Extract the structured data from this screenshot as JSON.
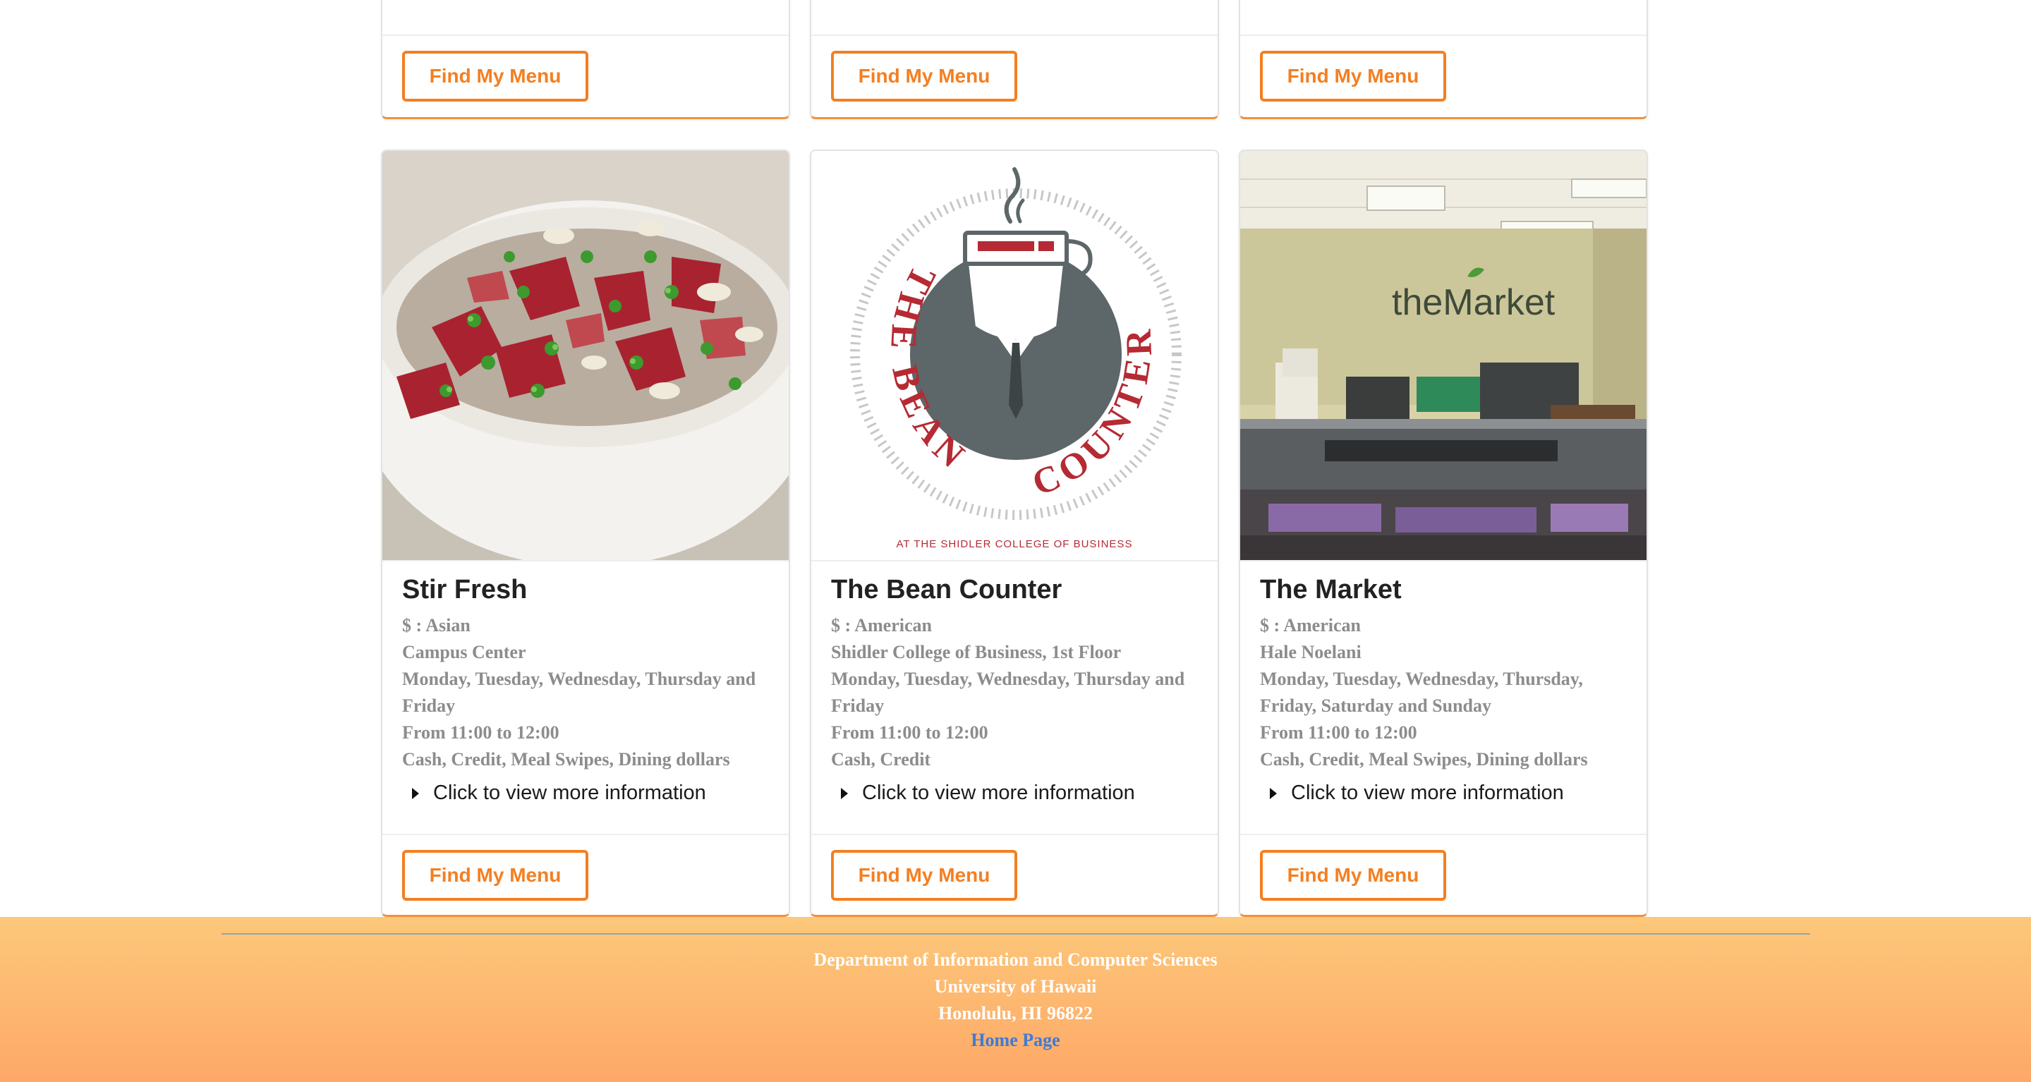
{
  "colors": {
    "accent": "#f47f21",
    "footer_top": "#fcc87a",
    "footer_bottom": "#fea867",
    "link": "#3f7ad6"
  },
  "top_cards": [
    {
      "button_label": "Find My Menu"
    },
    {
      "button_label": "Find My Menu"
    },
    {
      "button_label": "Find My Menu"
    }
  ],
  "cards": [
    {
      "name": "Stir Fresh",
      "price_cuisine": "$ : Asian",
      "location": "Campus Center",
      "days": "Monday, Tuesday, Wednesday, Thursday and Friday",
      "hours": "From 11:00 to 12:00",
      "payment": "Cash, Credit, Meal Swipes, Dining dollars",
      "more_label": "Click to view more information",
      "button_label": "Find My Menu",
      "image": "poke-bowl-photo"
    },
    {
      "name": "The Bean Counter",
      "price_cuisine": "$ : American",
      "location": "Shidler College of Business, 1st Floor",
      "days": "Monday, Tuesday, Wednesday, Thursday and Friday",
      "hours": "From 11:00 to 12:00",
      "payment": "Cash, Credit",
      "more_label": "Click to view more information",
      "button_label": "Find My Menu",
      "image": "bean-counter-logo",
      "logo_text": "THE BEAN COUNTER",
      "logo_caption": "AT THE SHIDLER COLLEGE OF BUSINESS"
    },
    {
      "name": "The Market",
      "price_cuisine": "$ : American",
      "location": "Hale Noelani",
      "days": "Monday, Tuesday, Wednesday, Thursday, Friday, Saturday and Sunday",
      "hours": "From 11:00 to 12:00",
      "payment": "Cash, Credit, Meal Swipes, Dining dollars",
      "more_label": "Click to view more information",
      "button_label": "Find My Menu",
      "image": "market-interior-photo",
      "sign_text": "theMarket"
    }
  ],
  "footer": {
    "line1": "Department of Information and Computer Sciences",
    "line2": "University of Hawaii",
    "line3": "Honolulu, HI 96822",
    "link": "Home Page"
  }
}
